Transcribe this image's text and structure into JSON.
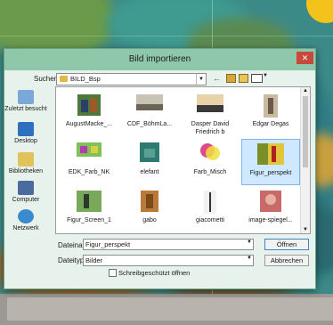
{
  "dialog": {
    "title": "Bild importieren",
    "close_label": "✕",
    "look_in_label": "Suchen in:",
    "look_in_value": "BILD_Bsp"
  },
  "toolbar_icons": [
    "back-arrow-icon",
    "folder-up-icon",
    "new-folder-icon",
    "view-menu-icon"
  ],
  "places": [
    {
      "label": "Zuletzt besucht",
      "icon": "recent-places-icon"
    },
    {
      "label": "Desktop",
      "icon": "desktop-icon"
    },
    {
      "label": "Bibliotheken",
      "icon": "libraries-icon"
    },
    {
      "label": "Computer",
      "icon": "computer-icon"
    },
    {
      "label": "Netzwerk",
      "icon": "network-icon"
    }
  ],
  "files": [
    {
      "name": "AugustMacke_...",
      "selected": false
    },
    {
      "name": "CDF_BöhmLa...",
      "selected": false
    },
    {
      "name": "Dasper David Friedrich b",
      "selected": false
    },
    {
      "name": "Edgar Degas",
      "selected": false
    },
    {
      "name": "EDK_Farb_NK",
      "selected": false
    },
    {
      "name": "elefant",
      "selected": false
    },
    {
      "name": "Farb_Misch",
      "selected": false
    },
    {
      "name": "Figur_perspekt",
      "selected": true
    },
    {
      "name": "Figur_Screen_1",
      "selected": false
    },
    {
      "name": "gabo",
      "selected": false
    },
    {
      "name": "giacometti",
      "selected": false
    },
    {
      "name": "image-spiegel...",
      "selected": false
    }
  ],
  "filename": {
    "label": "Dateiname:",
    "value": "Figur_perspekt"
  },
  "filetype": {
    "label": "Dateityp:",
    "value": "Bilder"
  },
  "readonly": {
    "label": "Schreibgeschützt öffnen",
    "checked": false
  },
  "buttons": {
    "open": "Öffnen",
    "cancel": "Abbrechen"
  },
  "colors": {
    "titlebar": "#8ec7a9",
    "selection": "#cde8ff",
    "close": "#c9483c",
    "dialog_bg": "#e7f2ec"
  }
}
